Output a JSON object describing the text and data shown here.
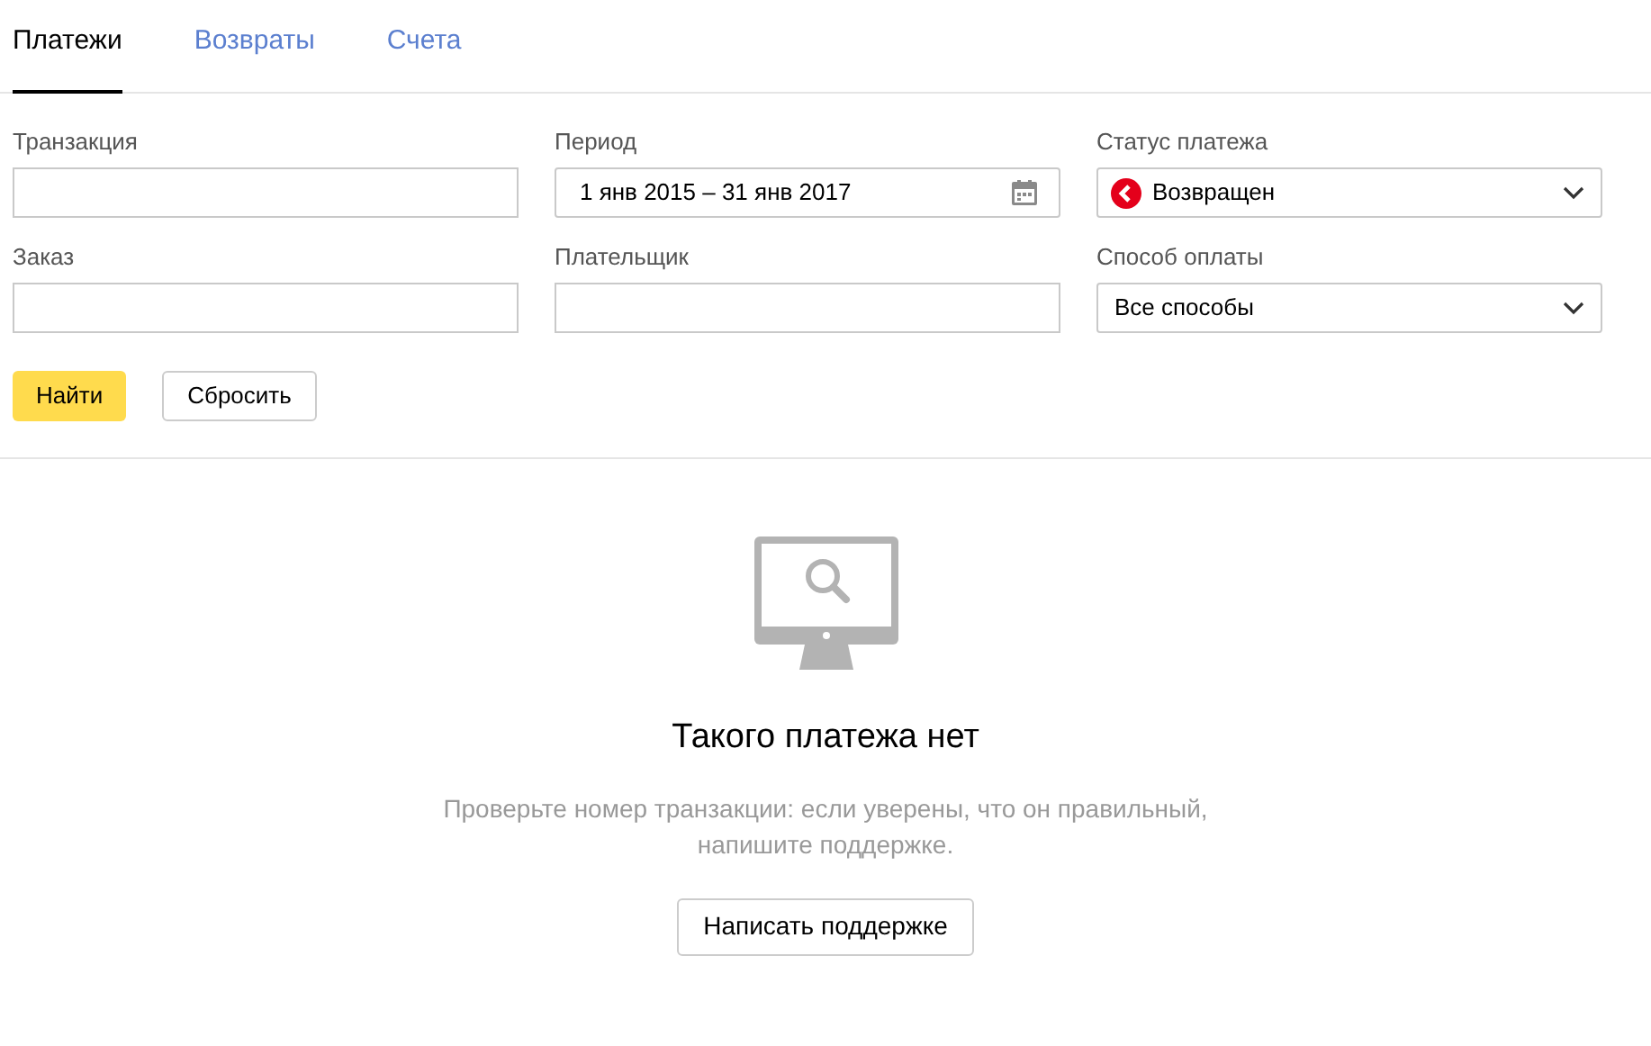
{
  "tabs": [
    {
      "label": "Платежи",
      "selected": true
    },
    {
      "label": "Возвраты",
      "selected": false
    },
    {
      "label": "Счета",
      "selected": false
    }
  ],
  "filters": [
    {
      "kind": "text",
      "label": "Транзакция"
    },
    {
      "kind": "date",
      "label": "Период",
      "value": "1 янв 2015 – 31 янв 2017"
    },
    {
      "kind": "status",
      "label": "Статус платежа",
      "value": "Возвращен"
    },
    {
      "kind": "text",
      "label": "Заказ"
    },
    {
      "kind": "text",
      "label": "Плательщик"
    },
    {
      "kind": "select",
      "label": "Способ оплаты",
      "value": "Все способы"
    }
  ],
  "buttons": [
    {
      "kind": "primary",
      "label": "Найти"
    },
    {
      "kind": "secondary",
      "label": "Сбросить"
    }
  ],
  "empty_state": {
    "title": "Такого платежа нет",
    "text": "Проверьте номер транзакции: если уверены, что он правильный, напишите поддержке.",
    "button": "Написать поддержке"
  }
}
